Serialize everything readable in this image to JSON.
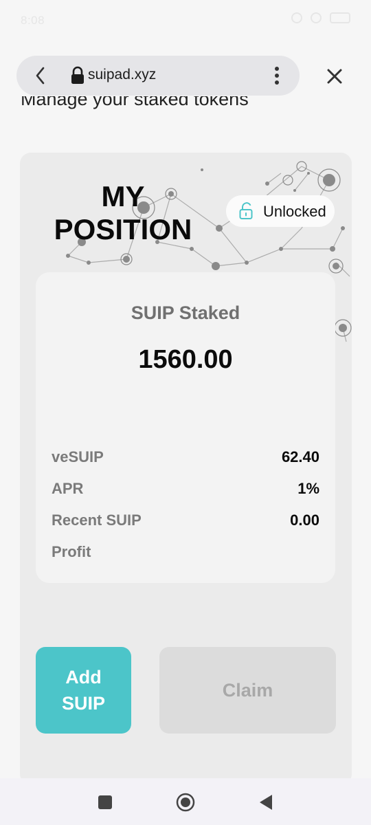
{
  "status_bar": {
    "time": "8:08"
  },
  "browser": {
    "url": "suipad.xyz"
  },
  "page": {
    "heading": "Manage your staked tokens"
  },
  "card": {
    "title": "MY POSITION",
    "lock_status": "Unlocked",
    "staked_label": "SUIP Staked",
    "staked_value": "1560.00",
    "rows": [
      {
        "label": "veSUIP",
        "value": "62.40"
      },
      {
        "label": "APR",
        "value": "1%"
      },
      {
        "label": "Recent SUIP\nProfit",
        "value": "0.00"
      }
    ],
    "add_button": "Add SUIP",
    "claim_button": "Claim"
  },
  "colors": {
    "accent": "#4cc5c9",
    "claim_disabled": "#dcdcdc",
    "badge_icon": "#4cc5c9"
  },
  "icons": [
    "back-icon",
    "lock-icon",
    "kebab-menu-icon",
    "close-icon",
    "unlock-icon",
    "recents-icon",
    "home-icon",
    "back-nav-icon"
  ]
}
